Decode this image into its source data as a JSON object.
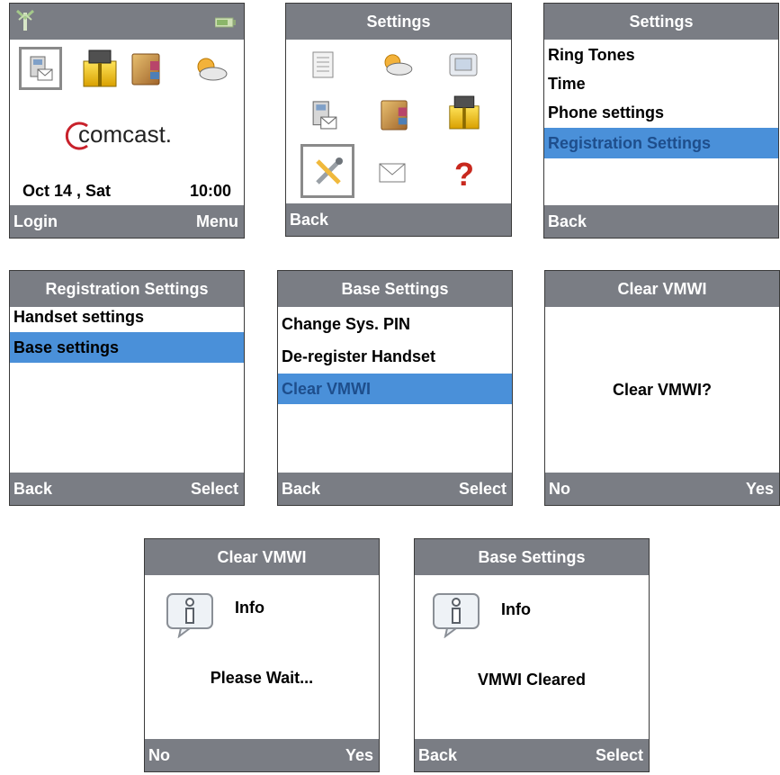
{
  "s1": {
    "logo": "comcast.",
    "date": "Oct 14 , Sat",
    "time": "10:00",
    "softkey_left": "Login",
    "softkey_right": "Menu"
  },
  "s2": {
    "title": "Settings",
    "softkey_left": "Back"
  },
  "s3": {
    "title": "Settings",
    "items": [
      "Ring Tones",
      "Time",
      "Phone settings",
      "Registration Settings"
    ],
    "softkey_left": "Back"
  },
  "s4": {
    "title": "Registration Settings",
    "items": [
      "Handset settings",
      "Base settings"
    ],
    "softkey_left": "Back",
    "softkey_right": "Select"
  },
  "s5": {
    "title": "Base Settings",
    "items": [
      "Change Sys. PIN",
      "De-register Handset",
      "Clear VMWI"
    ],
    "softkey_left": "Back",
    "softkey_right": "Select"
  },
  "s6": {
    "title": "Clear VMWI",
    "question": "Clear VMWI?",
    "softkey_left": "No",
    "softkey_right": "Yes"
  },
  "s7": {
    "title": "Clear VMWI",
    "info_label": "Info",
    "message": "Please Wait...",
    "softkey_left": "No",
    "softkey_right": "Yes"
  },
  "s8": {
    "title": "Base Settings",
    "info_label": "Info",
    "message": "VMWI Cleared",
    "softkey_left": "Back",
    "softkey_right": "Select"
  },
  "colors": {
    "bar": "#7a7d84",
    "highlight": "#4a90d9",
    "highlight_text": "#1e4e8c"
  }
}
